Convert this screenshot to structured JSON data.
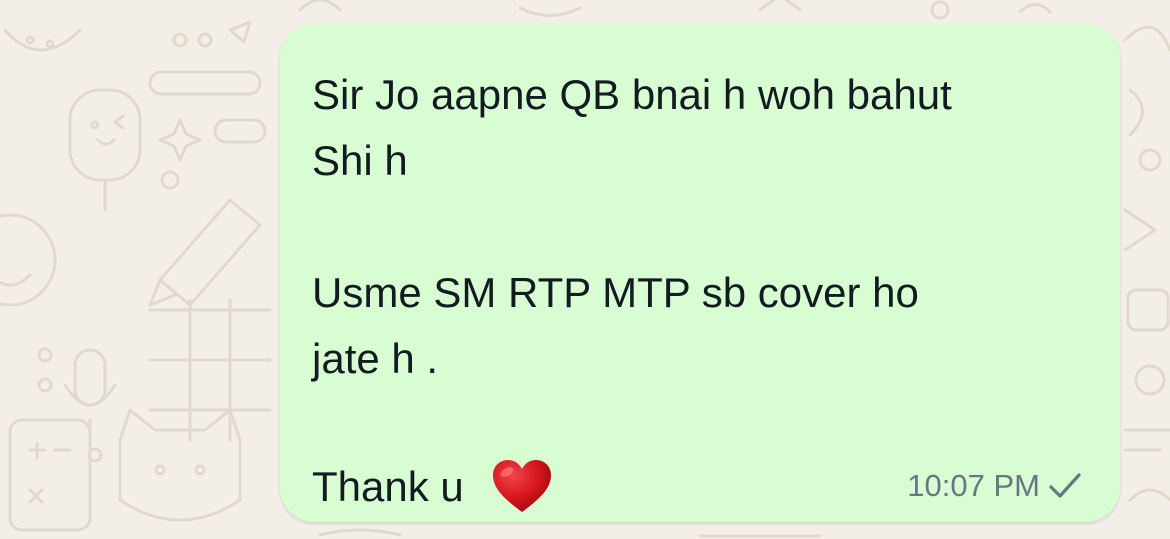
{
  "chat": {
    "message": {
      "line1": "Sir Jo aapne QB bnai h woh bahut",
      "line2": "Shi h",
      "line3": "Usme SM RTP MTP sb cover ho",
      "line4": "jate h .",
      "line5": "Thank u",
      "emoji": "red-heart",
      "time": "10:07 PM",
      "status_icon": "single-check-icon"
    },
    "colors": {
      "bubble": "#d9fdd3",
      "wallpaper": "#f3efe8",
      "text": "#111b21",
      "meta": "#667781"
    }
  }
}
